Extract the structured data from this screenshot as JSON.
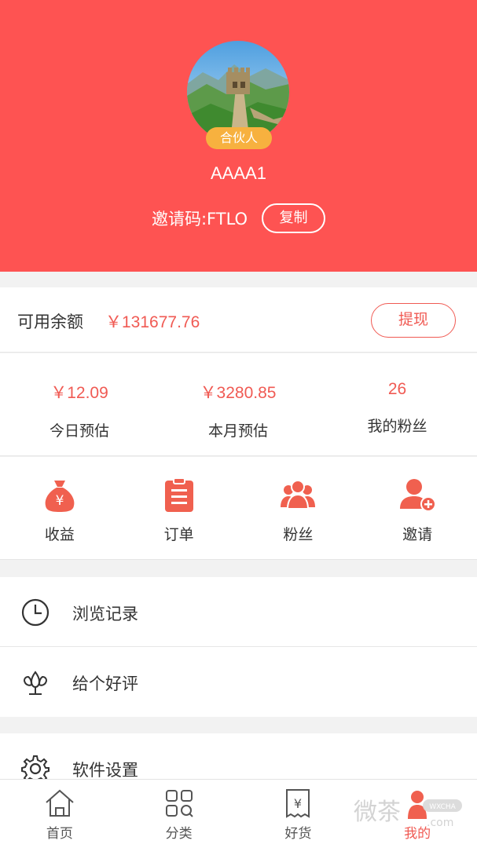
{
  "profile": {
    "badge": "合伙人",
    "username": "AAAA1",
    "invite_code": "邀请码:FTLO",
    "copy_label": "复制"
  },
  "balance": {
    "label": "可用余额",
    "value": "￥131677.76",
    "withdraw_label": "提现"
  },
  "stats": [
    {
      "value": "￥12.09",
      "label": "今日预估"
    },
    {
      "value": "￥3280.85",
      "label": "本月预估"
    },
    {
      "value": "26",
      "label": "我的粉丝"
    }
  ],
  "quick_actions": [
    {
      "label": "收益",
      "icon": "money-bag-icon"
    },
    {
      "label": "订单",
      "icon": "clipboard-icon"
    },
    {
      "label": "粉丝",
      "icon": "fans-icon"
    },
    {
      "label": "邀请",
      "icon": "invite-user-icon"
    }
  ],
  "menu": [
    {
      "label": "浏览记录",
      "icon": "clock-icon"
    },
    {
      "label": "给个好评",
      "icon": "flower-icon"
    },
    {
      "label": "软件设置",
      "icon": "gear-icon"
    }
  ],
  "tabs": [
    {
      "label": "首页",
      "icon": "home-icon",
      "active": false
    },
    {
      "label": "分类",
      "icon": "category-icon",
      "active": false
    },
    {
      "label": "好货",
      "icon": "receipt-icon",
      "active": false
    },
    {
      "label": "我的",
      "icon": "me-icon",
      "active": true
    }
  ],
  "colors": {
    "header_bg": "#fe5352",
    "accent": "#f05a53",
    "badge": "#f7b13f"
  }
}
